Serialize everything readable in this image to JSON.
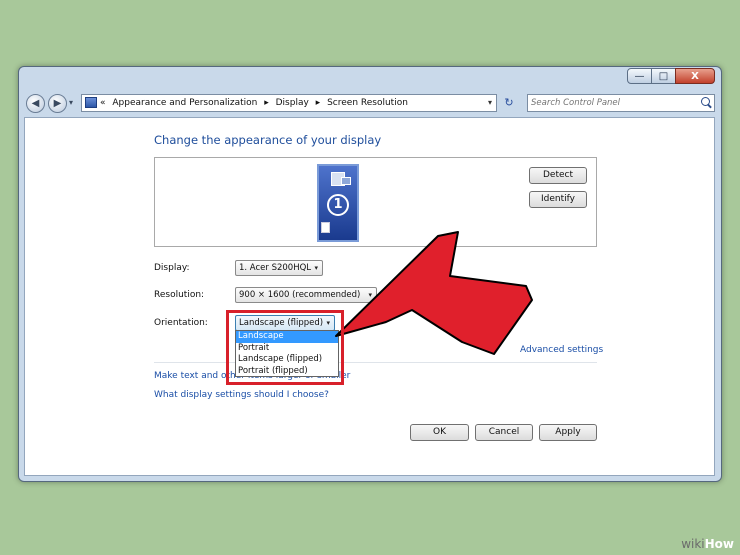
{
  "window": {
    "controls": {
      "minimize": "—",
      "maximize": "□",
      "close": "X"
    }
  },
  "nav": {
    "back": "◀",
    "forward": "▶",
    "history_dropdown": "▾",
    "breadcrumb_overflow": "«",
    "breadcrumbs": [
      "Appearance and Personalization",
      "Display",
      "Screen Resolution"
    ],
    "address_dropdown": "▾",
    "refresh": "↻",
    "search_placeholder": "Search Control Panel"
  },
  "page": {
    "title": "Change the appearance of your display",
    "monitor_number": "1",
    "detect_label": "Detect",
    "identify_label": "Identify",
    "display_label": "Display:",
    "display_value": "1. Acer S200HQL",
    "resolution_label": "Resolution:",
    "resolution_value": "900 × 1600 (recommended)",
    "orientation_label": "Orientation:",
    "orientation_value": "Landscape (flipped)",
    "combo_arrow": "▾",
    "orientation_options": [
      "Landscape",
      "Portrait",
      "Landscape (flipped)",
      "Portrait (flipped)"
    ],
    "orientation_highlighted_index": 0,
    "advanced_link": "Advanced settings",
    "make_text_link": "Make text and other items larger or smaller",
    "which_settings_link": "What display settings should I choose?",
    "ok_label": "OK",
    "cancel_label": "Cancel",
    "apply_label": "Apply"
  },
  "overlay": {
    "arrow_color": "#e0202c",
    "highlight_color": "#d8202a"
  },
  "watermark": {
    "wiki": "wiki",
    "how": "How"
  }
}
